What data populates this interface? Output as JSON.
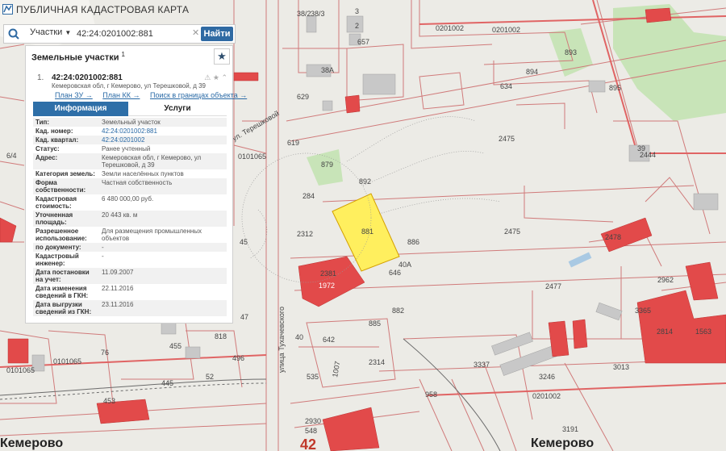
{
  "app": {
    "title": "Публичная кадастровая карта"
  },
  "search": {
    "type_label": "Участки",
    "query": "42:24:0201002:881",
    "button": "Найти"
  },
  "panel": {
    "heading": "Земельные участки",
    "heading_count": "1",
    "parcel": {
      "index": "1.",
      "id": "42:24:0201002:881",
      "address": "Кемеровская обл, г Кемерово, ул Терешковой, д 39"
    },
    "links": [
      "План ЗУ →",
      "План КК →",
      "Поиск в границах объекта →"
    ],
    "tabs": [
      "Информация",
      "Услуги"
    ],
    "attributes": [
      {
        "label": "Тип:",
        "value": "Земельный участок"
      },
      {
        "label": "Кад. номер:",
        "value": "42:24:0201002:881"
      },
      {
        "label": "Кад. квартал:",
        "value": "42:24:0201002"
      },
      {
        "label": "Статус:",
        "value": "Ранее учтенный"
      },
      {
        "label": "Адрес:",
        "value": "Кемеровская обл, г Кемерово, ул Терешковой, д 39"
      },
      {
        "label": "Категория земель:",
        "value": "Земли населённых пунктов"
      },
      {
        "label": "Форма собственности:",
        "value": "Частная собственность"
      },
      {
        "label": "Кадастровая стоимость:",
        "value": "6 480 000,00 руб."
      },
      {
        "label": "Уточненная площадь:",
        "value": "20 443 кв. м"
      },
      {
        "label": "Разрешенное использование:",
        "value": "Для размещения промышленных объектов"
      },
      {
        "label": "по документу:",
        "value": "-"
      },
      {
        "label": "Кадастровый инженер:",
        "value": "-"
      },
      {
        "label": "Дата постановки на учет:",
        "value": "11.09.2007"
      },
      {
        "label": "Дата изменения сведений в ГКН:",
        "value": "22.11.2016"
      },
      {
        "label": "Дата выгрузки сведений из ГКН:",
        "value": "23.11.2016"
      }
    ]
  },
  "map": {
    "city_labels": [
      "Кемерово",
      "Кемерово"
    ],
    "road_number": "42",
    "street_labels": [
      "улица Тухачевского",
      "ул. Терешковой"
    ],
    "quarter_labels": [
      "0201002",
      "0201002",
      "0101065",
      "0101065",
      "0101065"
    ],
    "selected_parcel_label": "881",
    "parcel_labels": [
      "893",
      "894",
      "895",
      "2444",
      "39",
      "2475",
      "2475",
      "892",
      "886",
      "284",
      "2312",
      "646",
      "40A",
      "2381",
      "1972",
      "2477",
      "2478",
      "2962",
      "3365",
      "882",
      "885",
      "642",
      "2314",
      "535",
      "1007",
      "958",
      "3246",
      "3191",
      "2930",
      "548",
      "3337",
      "3013",
      "2814",
      "1563",
      "455",
      "445",
      "453",
      "76",
      "47",
      "45",
      "496",
      "3",
      "2",
      "657",
      "38A",
      "38/2",
      "38/3",
      "619",
      "879",
      "818",
      "629",
      "634",
      "52",
      "6/4",
      "40"
    ],
    "colors": {
      "background": "#ecebe6",
      "line": "#d07a7a",
      "building": "#e24a4a",
      "selected": "#ffef5e",
      "green": "#c8e4b8",
      "water": "#a9c9e3",
      "grey": "#c8c8c8"
    }
  }
}
